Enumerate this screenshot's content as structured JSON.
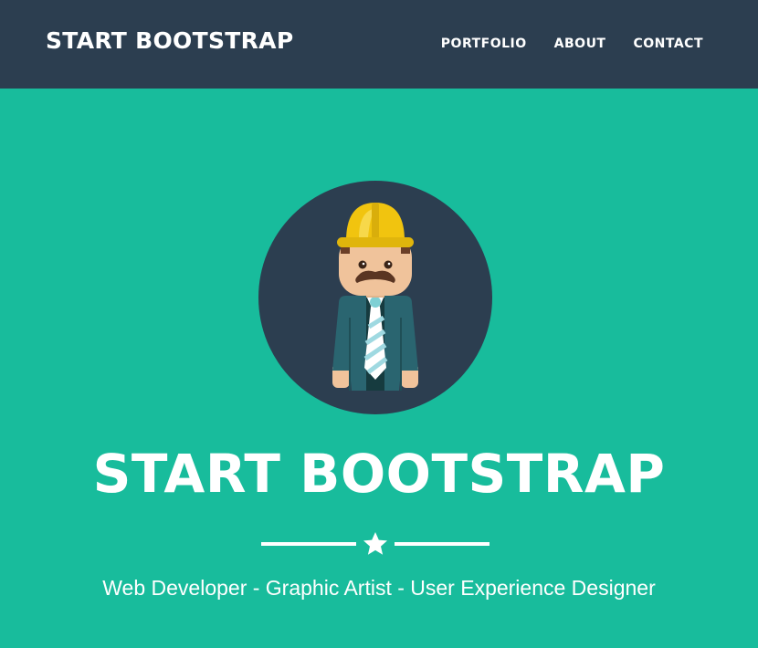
{
  "navbar": {
    "brand": "START BOOTSTRAP",
    "links": [
      {
        "label": "PORTFOLIO"
      },
      {
        "label": "ABOUT"
      },
      {
        "label": "CONTACT"
      }
    ]
  },
  "hero": {
    "avatar_icon": "construction-worker-avatar",
    "title": "START BOOTSTRAP",
    "divider_icon": "star-icon",
    "skills": "Web Developer - Graphic Artist - User Experience Designer"
  },
  "colors": {
    "navbar_bg": "#2c3e50",
    "hero_bg": "#18bc9c",
    "text": "#ffffff",
    "helmet": "#f1c40f"
  }
}
